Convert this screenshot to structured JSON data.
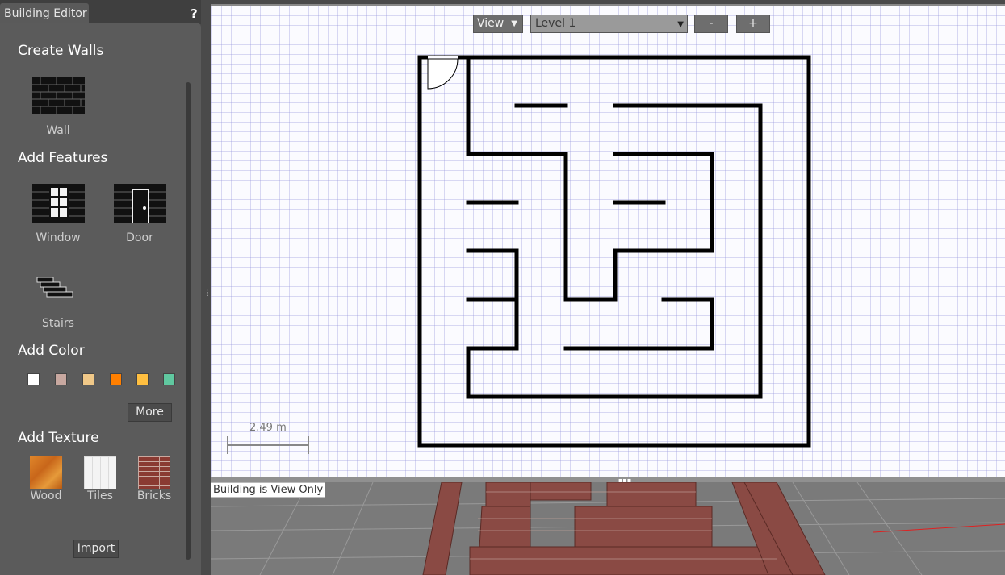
{
  "panel": {
    "tab_title": "Building Editor",
    "help": "?",
    "sections": {
      "create_walls": "Create Walls",
      "add_features": "Add Features",
      "add_color": "Add Color",
      "add_texture": "Add Texture"
    },
    "tools": {
      "wall": "Wall",
      "window": "Window",
      "door": "Door",
      "stairs": "Stairs"
    },
    "colors": [
      "#ffffff",
      "#c8a8a0",
      "#f0c888",
      "#ff7f00",
      "#ffbf40",
      "#60c8a0"
    ],
    "more_button": "More",
    "textures": {
      "wood": "Wood",
      "tiles": "Tiles",
      "bricks": "Bricks"
    },
    "import_button": "Import"
  },
  "editor": {
    "view_menu": "View",
    "level_select": "Level 1",
    "minus_button": "-",
    "plus_button": "+",
    "scale_label": "2.49 m"
  },
  "status": {
    "text": "Building is View Only"
  }
}
